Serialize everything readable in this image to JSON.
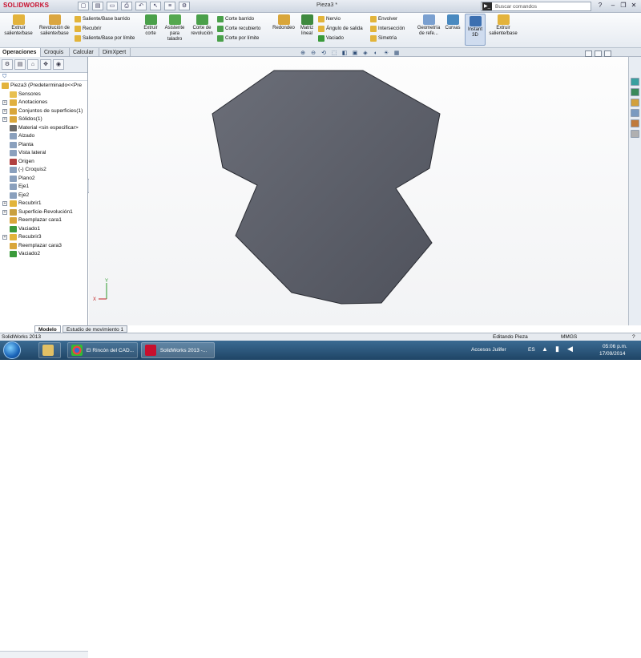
{
  "app": {
    "logo": "SOLIDWORKS",
    "document_title": "Pieza3 *",
    "search_placeholder": "Buscar comandos",
    "search_icon_glyph": "▶_",
    "help_glyph": "?",
    "window_controls": [
      "–",
      "❐",
      "✕"
    ]
  },
  "quick_access": [
    "▢",
    "▤",
    "▭",
    "⎙",
    "↶",
    "↖",
    "≡",
    "⚙"
  ],
  "ribbon": {
    "extrude_boss": "Extruir saliente/base",
    "revolve_boss": "Revolución de saliente/base",
    "swept_boss": "Saliente/Base barrido",
    "loft": "Recubrir",
    "boundary_boss": "Saliente/Base por límite",
    "extrude_cut": "Extruir corte",
    "hole_wizard": "Asistente para taladro",
    "revolve_cut": "Corte de revolución",
    "swept_cut": "Corte barrido",
    "lofted_cut": "Corte recubierto",
    "boundary_cut": "Corte por límite",
    "fillet": "Redondeo",
    "linear_pattern": "Matriz lineal",
    "rib": "Nervio",
    "draft": "Ángulo de salida",
    "shell": "Vaciado",
    "wrap": "Envolver",
    "intersect": "Intersección",
    "mirror": "Simetría",
    "ref_geometry": "Geometría de refe...",
    "curves": "Curvas",
    "instant3d": "Instant 3D",
    "extrude_boss_2": "Extruir saliente/base"
  },
  "tabs": [
    "Operaciones",
    "Croquis",
    "Calcular",
    "DimXpert"
  ],
  "feature_manager": {
    "filter_glyph": "⛉",
    "toolbar": [
      "⚙",
      "▤",
      "⌂",
      "✥",
      "◉"
    ],
    "root": "Pieza3  (Predeterminado<<Pre",
    "items": [
      {
        "label": "Sensores",
        "expand": "",
        "color": "#e8c050"
      },
      {
        "label": "Anotaciones",
        "expand": "+",
        "color": "#e0b040"
      },
      {
        "label": "Conjuntos de superficies(1)",
        "expand": "+",
        "color": "#d9a63a"
      },
      {
        "label": "Sólidos(1)",
        "expand": "+",
        "color": "#d9a63a"
      },
      {
        "label": "Material <sin especificar>",
        "expand": "",
        "color": "#6a6a6a"
      },
      {
        "label": "Alzado",
        "expand": "",
        "color": "#8aa0bd"
      },
      {
        "label": "Planta",
        "expand": "",
        "color": "#8aa0bd"
      },
      {
        "label": "Vista lateral",
        "expand": "",
        "color": "#8aa0bd"
      },
      {
        "label": "Origen",
        "expand": "",
        "color": "#b04040"
      },
      {
        "label": "(-) Croquis2",
        "expand": "",
        "color": "#8aa0bd"
      },
      {
        "label": "Plano2",
        "expand": "",
        "color": "#8aa0bd"
      },
      {
        "label": "Eje1",
        "expand": "",
        "color": "#8aa0bd"
      },
      {
        "label": "Eje2",
        "expand": "",
        "color": "#8aa0bd"
      },
      {
        "label": "Recubrir1",
        "expand": "+",
        "color": "#e2b43a"
      },
      {
        "label": "Superficie-Revolución1",
        "expand": "+",
        "color": "#c9a040"
      },
      {
        "label": "Reemplazar cara1",
        "expand": "",
        "color": "#d9a63a"
      },
      {
        "label": "Vaciado1",
        "expand": "",
        "color": "#3a9a3a"
      },
      {
        "label": "Recubrir3",
        "expand": "+",
        "color": "#e2b43a"
      },
      {
        "label": "Reemplazar cara3",
        "expand": "",
        "color": "#d9a63a"
      },
      {
        "label": "Vaciado2",
        "expand": "",
        "color": "#3a9a3a"
      }
    ]
  },
  "view_toolbar": [
    "⊕",
    "⊖",
    "⟲",
    "⬚",
    "◧",
    "▣",
    "◈",
    "◐",
    "☀",
    "▦"
  ],
  "triad": {
    "x": "X",
    "y": "Y"
  },
  "bottom_tabs": [
    "Modelo",
    "Estudio de movimiento 1"
  ],
  "status": {
    "app_version": "SolidWorks 2013",
    "mode": "Editando Pieza",
    "units": "MMGS",
    "help": "?"
  },
  "taskbar": {
    "items": [
      "",
      "",
      "El Rincón del CAD...",
      "SolidWorks 2013 -..."
    ],
    "access": "Accesos Julifer",
    "lang": "ES",
    "time": "05:06 p.m.",
    "date": "17/09/2014"
  },
  "colors": {
    "part_fill": "#5c5f6a",
    "part_stroke": "#2a2c33",
    "solidworks_red": "#c8102e",
    "accent_blue": "#2f5d9a"
  }
}
